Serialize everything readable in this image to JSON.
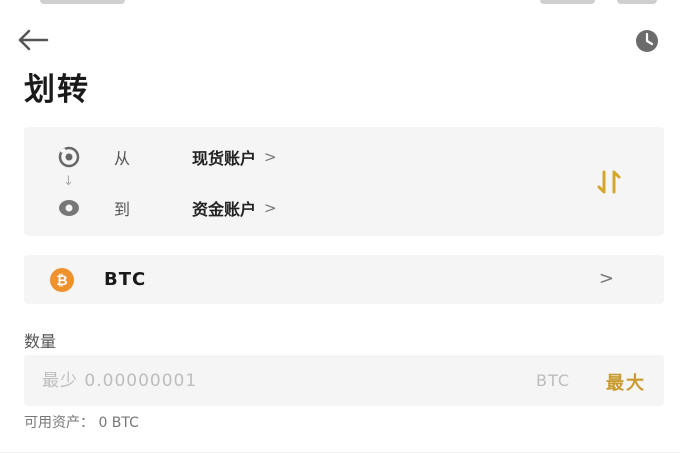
{
  "header": {
    "title": "划转",
    "back_icon": "arrow-left-icon",
    "history_icon": "clock-icon"
  },
  "transfer": {
    "from_label": "从",
    "from_account": "现货账户",
    "to_label": "到",
    "to_account": "资金账户",
    "chevron": ">",
    "down_arrow": "↓",
    "swap_icon": "swap-icon",
    "swap_color": "#d4a72c"
  },
  "coin": {
    "symbol": "₿",
    "name": "BTC",
    "chevron": ">",
    "icon_color": "#f0922b"
  },
  "amount": {
    "label": "数量",
    "placeholder": "最少 0.00000001",
    "unit": "BTC",
    "max_label": "最大",
    "max_color": "#c99a2e"
  },
  "available": {
    "text": "可用资产： 0 BTC"
  }
}
